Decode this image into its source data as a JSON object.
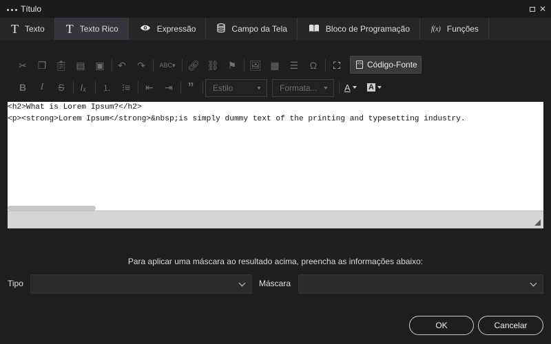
{
  "window": {
    "title": "Título"
  },
  "tabs": [
    {
      "label": "Texto",
      "icon": "text-icon"
    },
    {
      "label": "Texto Rico",
      "icon": "rich-text-icon",
      "active": true
    },
    {
      "label": "Expressão",
      "icon": "eye-icon"
    },
    {
      "label": "Campo da Tela",
      "icon": "database-icon"
    },
    {
      "label": "Bloco de Programação",
      "icon": "book-icon"
    },
    {
      "label": "Funções",
      "icon": "function-icon"
    }
  ],
  "toolbar": {
    "source_label": "Código-Fonte",
    "style_placeholder": "Estilo",
    "format_placeholder": "Formata..."
  },
  "editor": {
    "lines": [
      "<h2>What is Lorem Ipsum?</h2>",
      "",
      "<p><strong>Lorem Ipsum</strong>&nbsp;is simply dummy text of the printing and typesetting industry."
    ]
  },
  "mask": {
    "hint": "Para aplicar uma máscara ao resultado acima, preencha as informações abaixo:",
    "type_label": "Tipo",
    "mask_label": "Máscara",
    "type_value": "",
    "mask_value": ""
  },
  "buttons": {
    "ok": "OK",
    "cancel": "Cancelar"
  }
}
